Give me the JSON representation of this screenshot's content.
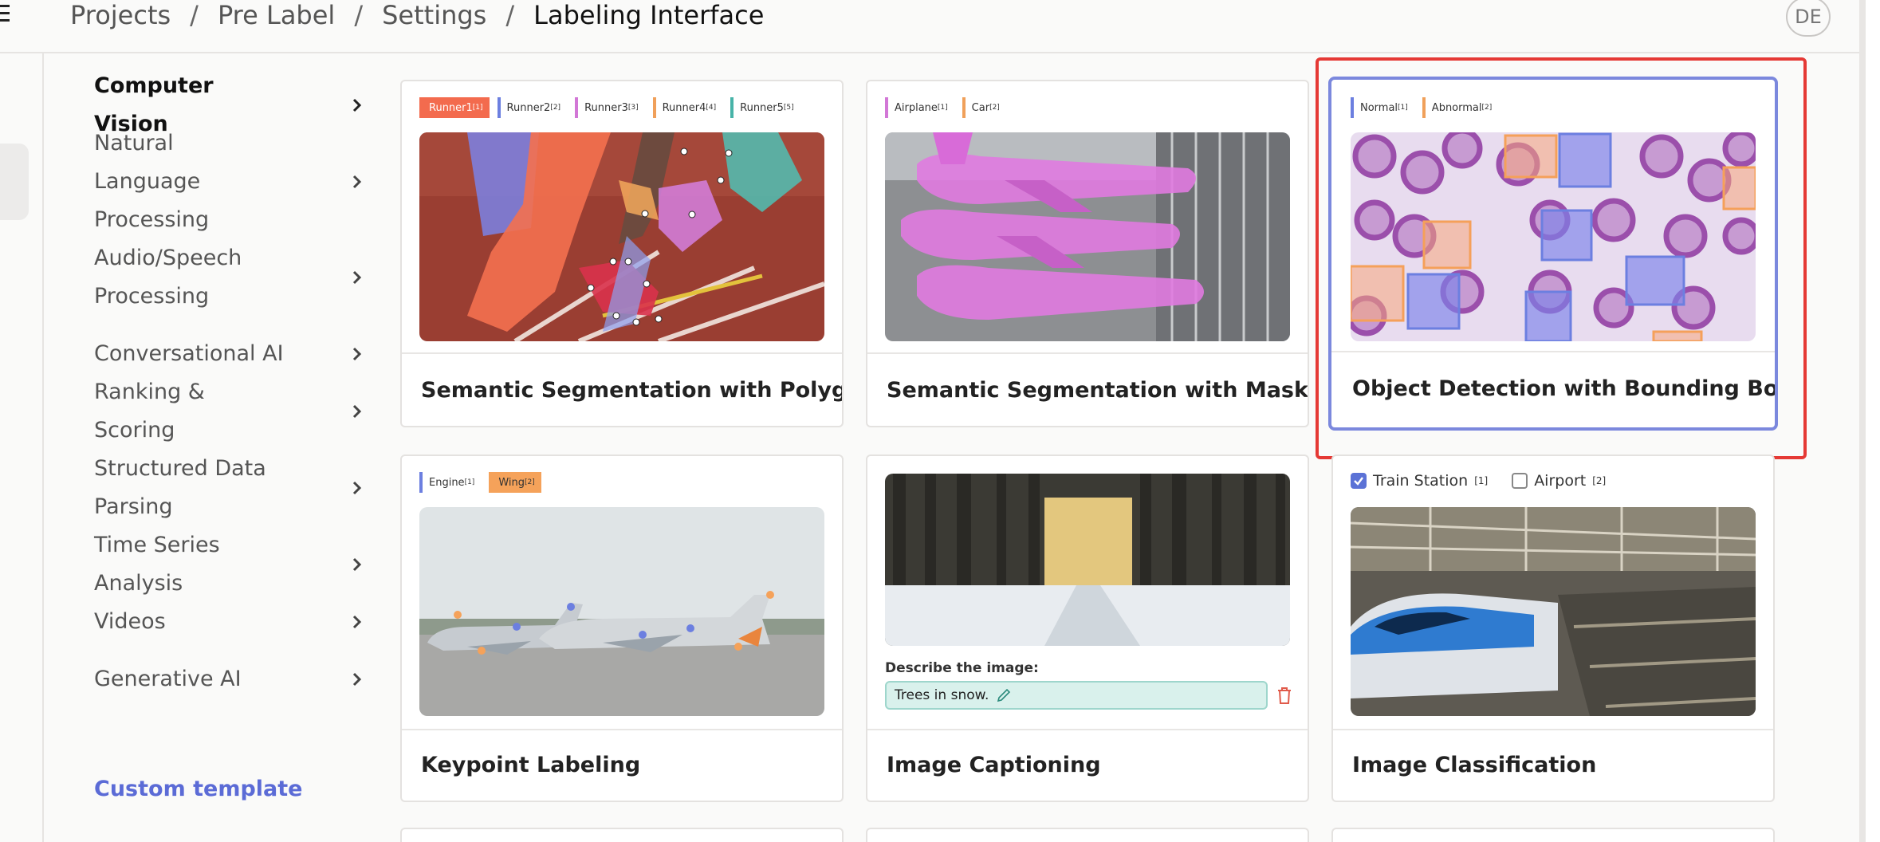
{
  "breadcrumb": [
    "Projects",
    "Pre Label",
    "Settings",
    "Labeling Interface"
  ],
  "user": {
    "initials": "DE"
  },
  "sidebar": {
    "items": [
      {
        "label": "Computer Vision",
        "active": true
      },
      {
        "label": "Natural Language Processing"
      },
      {
        "label": "Audio/Speech Processing"
      },
      {
        "label": "Conversational AI"
      },
      {
        "label": "Ranking & Scoring"
      },
      {
        "label": "Structured Data Parsing"
      },
      {
        "label": "Time Series Analysis"
      },
      {
        "label": "Videos"
      },
      {
        "label": "Generative AI"
      }
    ],
    "custom_template": "Custom template"
  },
  "cards": [
    {
      "title": "Semantic Segmentation with Polygons",
      "tags": [
        {
          "label": "Runner1",
          "idx": "[1]",
          "color": "#f36b4e",
          "filled": true
        },
        {
          "label": "Runner2",
          "idx": "[2]",
          "color": "#6c7fe0"
        },
        {
          "label": "Runner3",
          "idx": "[3]",
          "color": "#d277d6"
        },
        {
          "label": "Runner4",
          "idx": "[4]",
          "color": "#f0a05a"
        },
        {
          "label": "Runner5",
          "idx": "[5]",
          "color": "#47b3a8"
        }
      ]
    },
    {
      "title": "Semantic Segmentation with Masks",
      "tags": [
        {
          "label": "Airplane",
          "idx": "[1]",
          "color": "#d277d6"
        },
        {
          "label": "Car",
          "idx": "[2]",
          "color": "#f0a05a"
        }
      ]
    },
    {
      "title": "Object Detection with Bounding Boxes",
      "selected": true,
      "tags": [
        {
          "label": "Normal",
          "idx": "[1]",
          "color": "#6c7fe0"
        },
        {
          "label": "Abnormal",
          "idx": "[2]",
          "color": "#f0a05a"
        }
      ]
    },
    {
      "title": "Keypoint Labeling",
      "tags": [
        {
          "label": "Engine",
          "idx": "[1]",
          "color": "#6c7fe0"
        },
        {
          "label": "Wing",
          "idx": "[2]",
          "color": "#f5a25a",
          "filled": true
        }
      ]
    },
    {
      "title": "Image Captioning",
      "caption_prompt": "Describe the image:",
      "caption_value": "Trees in snow."
    },
    {
      "title": "Image Classification",
      "choices": [
        {
          "label": "Train Station",
          "idx": "[1]",
          "checked": true
        },
        {
          "label": "Airport",
          "idx": "[2]",
          "checked": false
        }
      ]
    }
  ],
  "colors": {
    "accent": "#5b6bd6",
    "selection": "#e53935",
    "selected_card_border": "#7b88dd"
  },
  "icons": [
    "menu-icon",
    "chevron-right-icon",
    "pencil-icon",
    "trash-icon",
    "checkbox-icon"
  ]
}
